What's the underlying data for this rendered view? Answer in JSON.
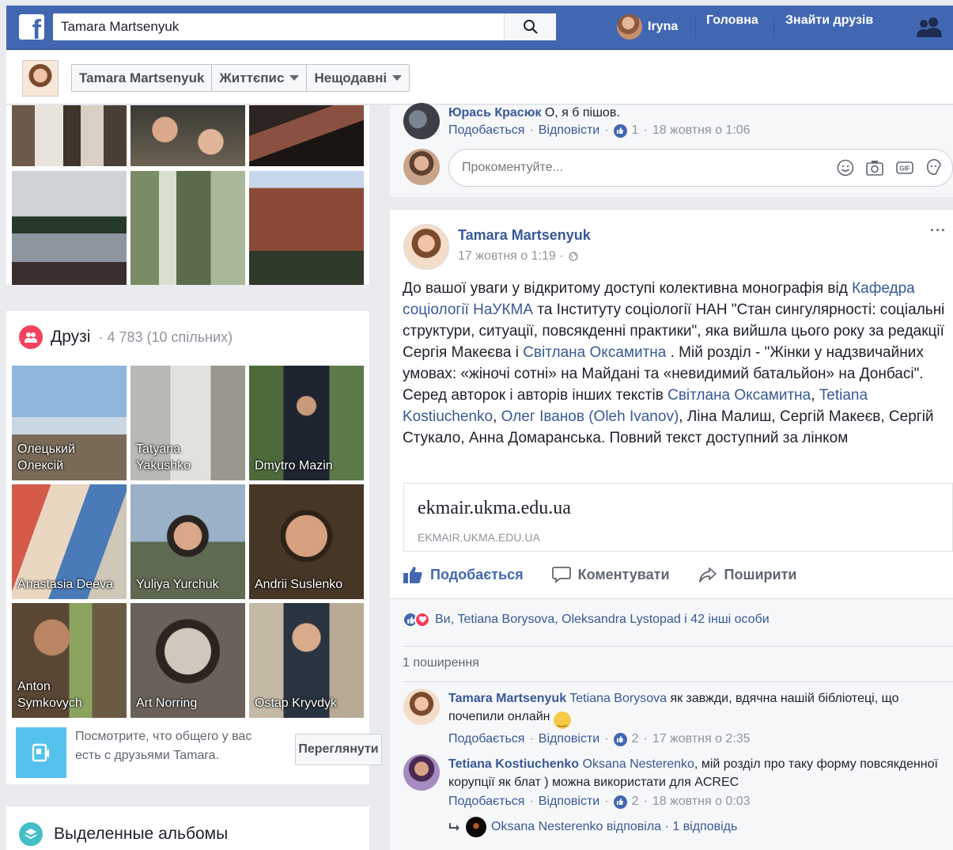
{
  "topbar": {
    "logo": "f",
    "search_value": "Tamara Martsenyuk",
    "user_name": "Iryna",
    "home": "Головна",
    "find_friends": "Знайти друзів"
  },
  "subheader": {
    "name": "Tamara Martsenyuk",
    "timeline": "Життєпис",
    "recent": "Нещодавні"
  },
  "friends": {
    "title": "Друзі",
    "count": "· 4 783 (10 спільних)",
    "items": [
      {
        "name": "Олецький Олексій"
      },
      {
        "name": "Tatyana Yakushko"
      },
      {
        "name": "Dmytro Mazin"
      },
      {
        "name": "Anastasia Deeva"
      },
      {
        "name": "Yuliya Yurchuk"
      },
      {
        "name": "Andrii Suslenko"
      },
      {
        "name": "Anton Symkovych"
      },
      {
        "name": "Art Norring"
      },
      {
        "name": "Ostap Kryvdyk"
      }
    ],
    "mutual_text": "Посмотрите, что общего у вас есть с друзьями Tamara.",
    "mutual_button": "Переглянути"
  },
  "albums": {
    "title": "Выделенные альбомы"
  },
  "prev_comment": {
    "author": "Юрась Красюк",
    "text": "О, я б пішов.",
    "like": "Подобається",
    "reply": "Відповісти",
    "likes": "1",
    "time": "18 жовтня о 1:06",
    "input_placeholder": "Прокоментуйте..."
  },
  "post": {
    "author": "Tamara Martsenyuk",
    "date": "17 жовтня о 1:19 ·",
    "more": "···",
    "body": {
      "t1": "До вашої уваги у відкритому доступі колективна монографія від ",
      "l1": "Кафедра соціології НаУКМА",
      "t2": " та Інституту соціології НАН \"Стан сингулярності: соціальні структури, ситуації, повсякденні практики\", яка вийшла цього року за редакції Сергія Макеєва і ",
      "l2": "Світлана Оксамитна",
      "t3": " . Мій розділ - \"Жінки у надзвичайних умовах: «жіночі сотні» на Майдані та «невидимий батальйон» на Донбасі\". Серед авторок і авторів інших текстів ",
      "l3": "Світлана Оксамитна",
      "t4": ", ",
      "l4": "Tetiana Kostiuchenko",
      "t5": ", ",
      "l5": "Олег Іванов (Oleh Ivanov)",
      "t6": ", Ліна Малиш, Сергій Макеєв, Сергій Стукало, Анна Домаранська. Повний текст доступний за лінком"
    },
    "link_title": "ekmair.ukma.edu.ua",
    "link_domain": "EKMAIR.UKMA.EDU.UA",
    "actions": {
      "like": "Подобається",
      "comment": "Коментувати",
      "share": "Поширити"
    },
    "reactions": "Ви, Tetiana Borysova, Oleksandra Lystopad і 42 інші особи",
    "shares": "1 поширення"
  },
  "comments": [
    {
      "author": "Tamara Martsenyuk",
      "mention": "Tetiana Borysova",
      "text": " як завжди, вдячна нашій бібліотеці, що почепили онлайн",
      "like": "Подобається",
      "reply": "Відповісти",
      "likes": "2",
      "time": "17 жовтня о 2:35"
    },
    {
      "author": "Tetiana Kostiuchenko",
      "mention": "Oksana Nesterenko",
      "text": ", мій розділ про таку форму повсякденної корупції як блат ) можна використати для ACREC",
      "like": "Подобається",
      "reply": "Відповісти",
      "likes": "2",
      "time": "18 жовтня о 0:03",
      "reply_summary": "Oksana Nesterenko відповіла · 1 відповідь"
    }
  ],
  "colors": {
    "brand": "#4267b2",
    "link": "#385898",
    "meta": "#90949c",
    "background": "#e9ebee"
  }
}
